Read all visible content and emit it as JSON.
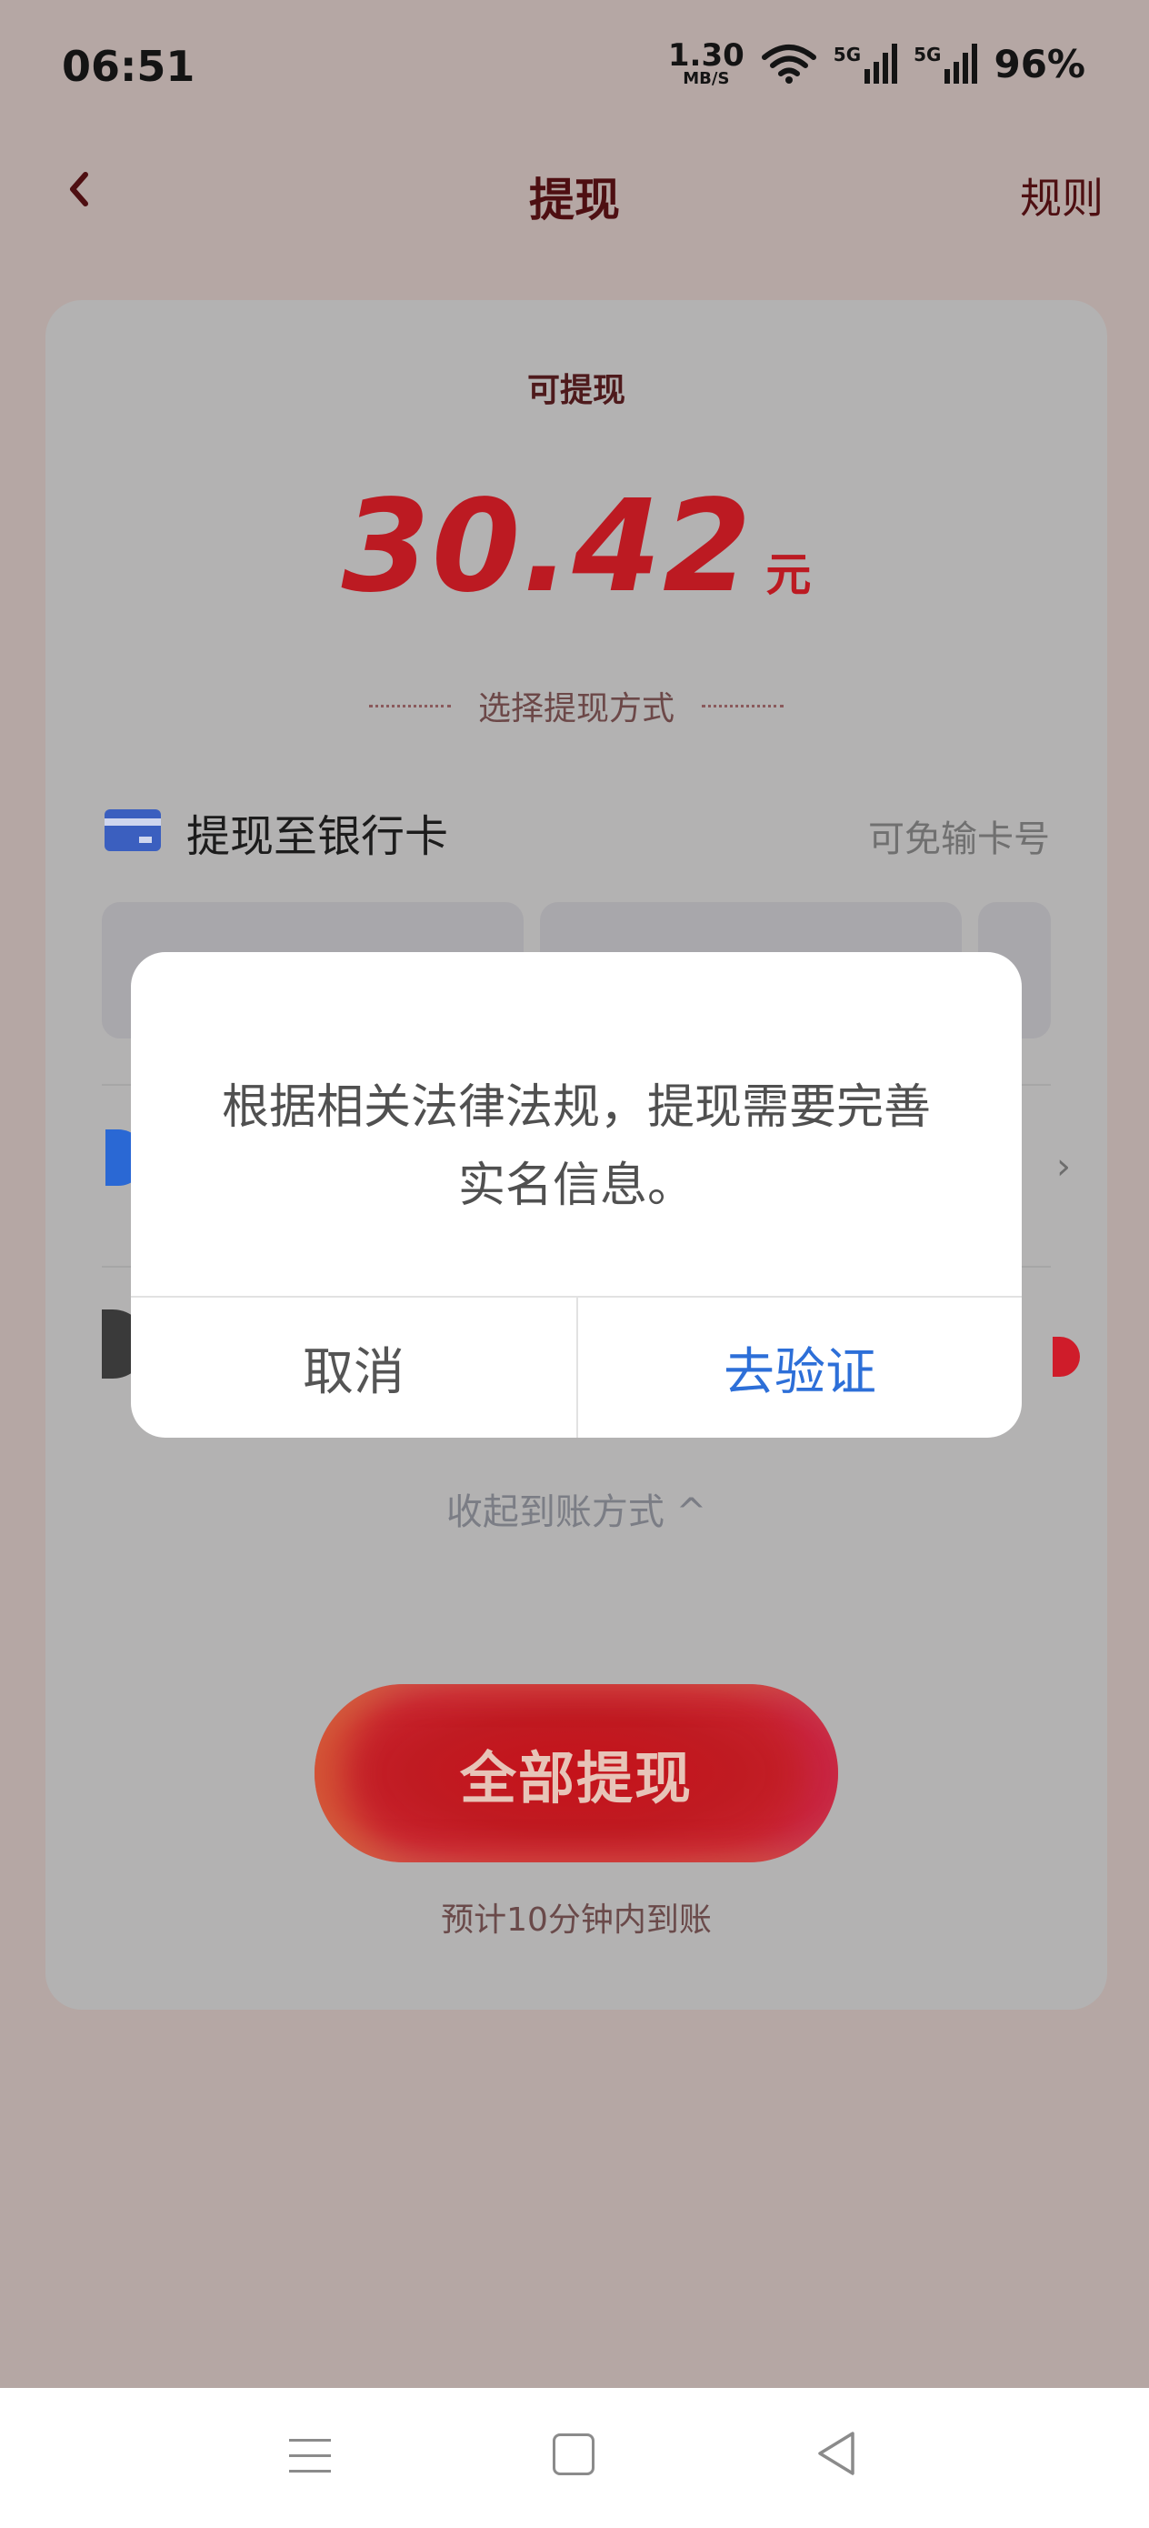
{
  "status": {
    "time": "06:51",
    "net_speed": "1.30",
    "net_unit": "MB/S",
    "sig1_label": "5G",
    "sig2_label": "5G",
    "battery": "96%"
  },
  "navbar": {
    "title": "提现",
    "rules": "规则"
  },
  "balance": {
    "label": "可提现",
    "amount": "30.42",
    "unit": "元"
  },
  "methods": {
    "label": "选择提现方式",
    "bank_title": "提现至银行卡",
    "bank_hint": "可免输卡号",
    "collapse": "收起到账方式 ^"
  },
  "withdraw": {
    "button": "全部提现",
    "eta": "预计10分钟内到账"
  },
  "dialog": {
    "message": "根据相关法律法规，提现需要完善实名信息。",
    "cancel": "取消",
    "confirm": "去验证"
  },
  "colors": {
    "accent_red": "#bc1a22",
    "dialog_link": "#2d6fd8"
  }
}
